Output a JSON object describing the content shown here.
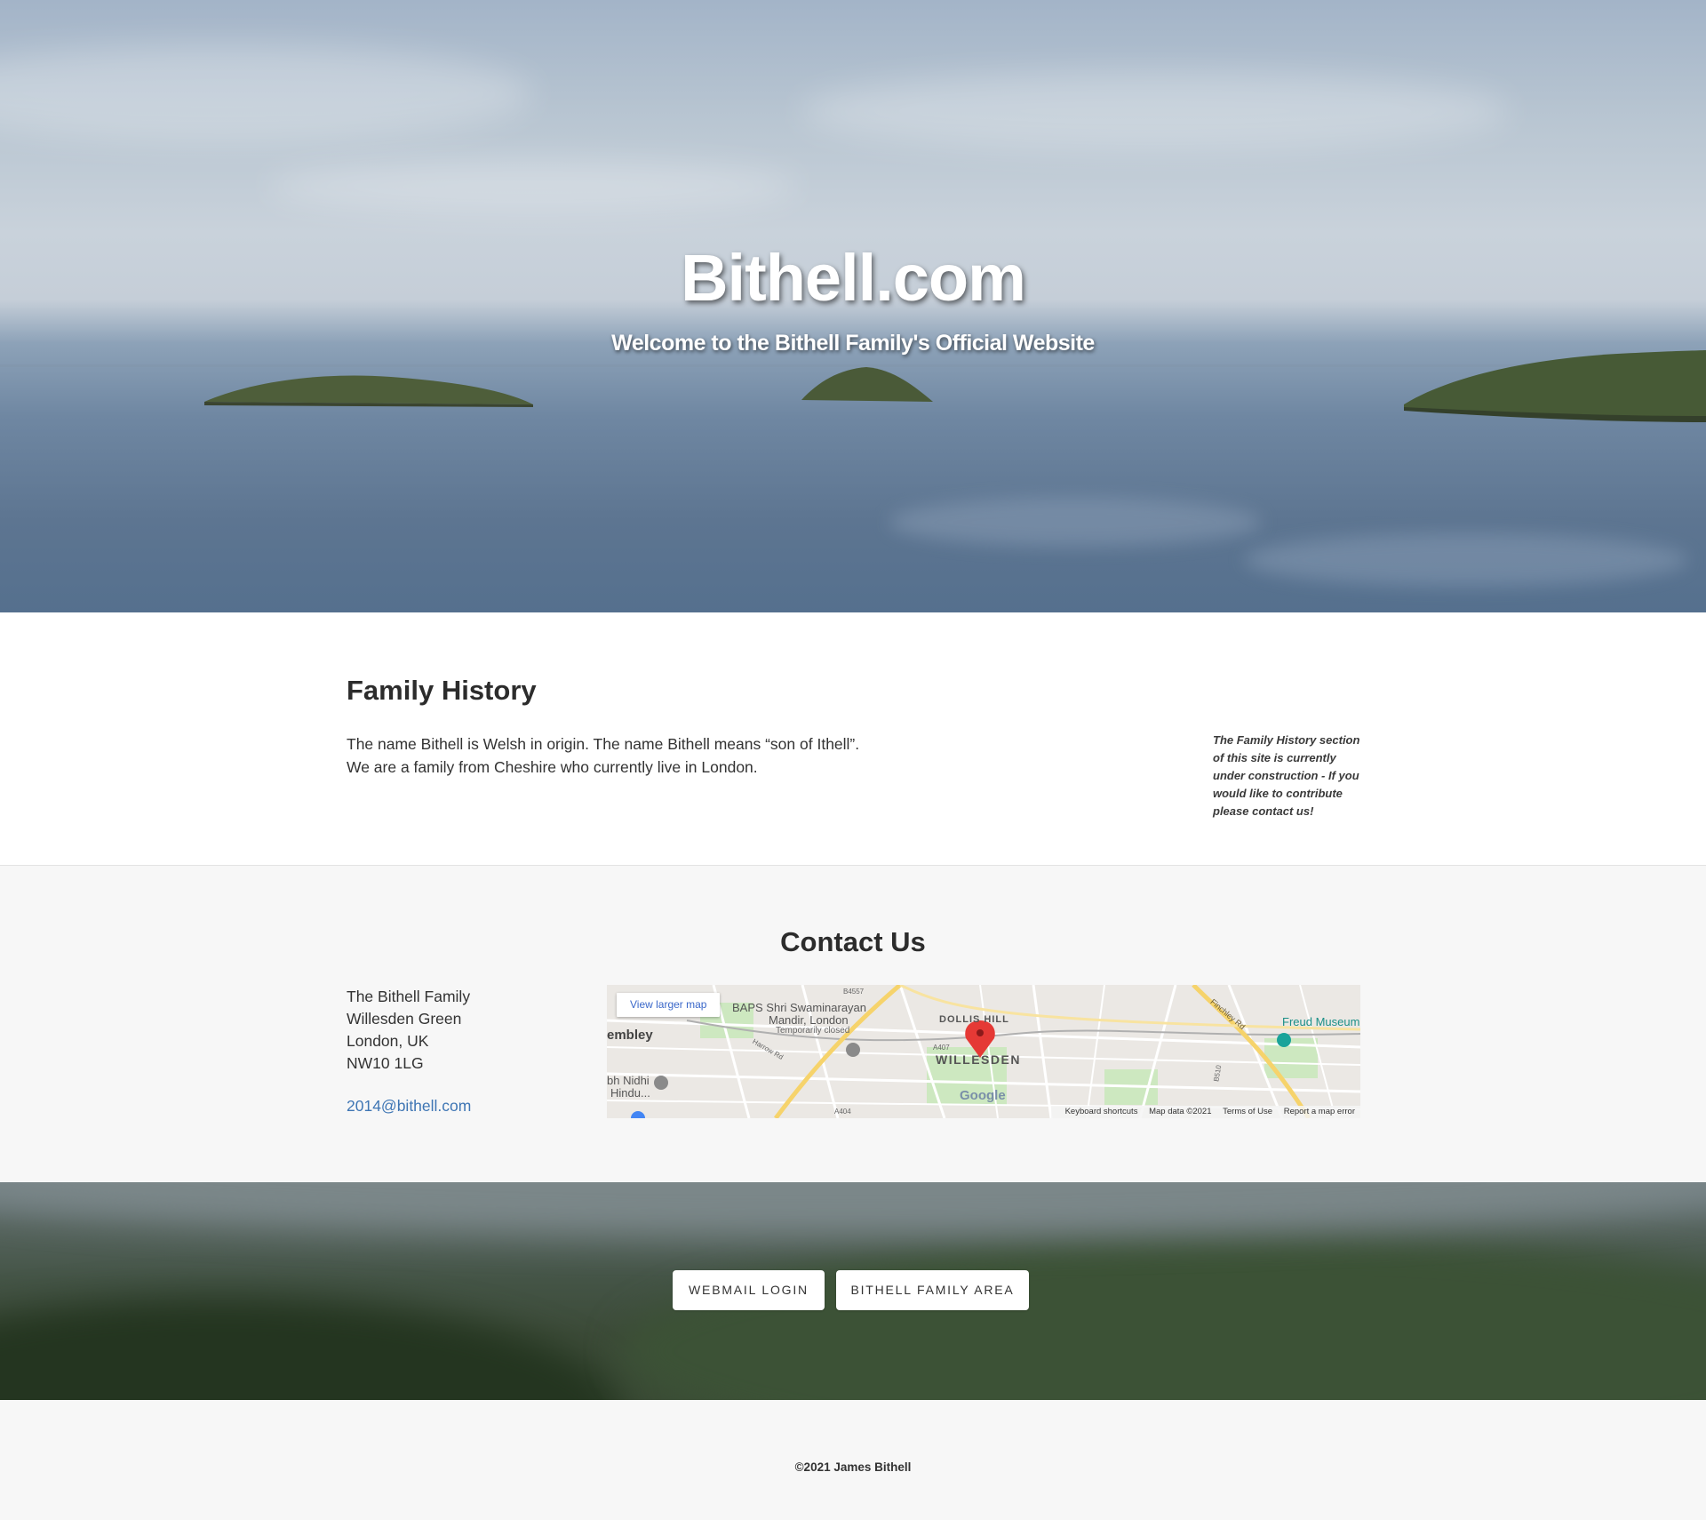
{
  "hero": {
    "title": "Bithell.com",
    "subtitle": "Welcome to the Bithell Family's Official Website"
  },
  "history": {
    "heading": "Family History",
    "lines": [
      "The name Bithell is Welsh in origin. The name Bithell means “son of Ithell”.",
      "We are a family from Cheshire who currently live in London."
    ],
    "note": "The Family History section of this site is currently under construction - If you would like to contribute please contact us!"
  },
  "contact": {
    "heading": "Contact Us",
    "address": [
      "The Bithell Family",
      "Willesden Green",
      "London, UK",
      "NW10 1LG"
    ],
    "email": "2014@bithell.com"
  },
  "map": {
    "view_larger": "View larger map",
    "labels": {
      "baps": "BAPS Shri Swaminarayan",
      "mandir": "Mandir, London",
      "temp_closed": "Temporarily closed",
      "wembley": "embley",
      "dollis_hill": "DOLLIS HILL",
      "willesden": "WILLESDEN",
      "freud": "Freud Museum L",
      "nidhi1": "bh Nidhi",
      "nidhi2": "Hindu...",
      "finchley": "Finchley Rd",
      "harrow": "Harrow Rd",
      "b4557": "B4557",
      "a407": "A407",
      "a404": "A404",
      "b510": "B510"
    },
    "google": "Google",
    "footer": [
      "Keyboard shortcuts",
      "Map data ©2021",
      "Terms of Use",
      "Report a map error"
    ]
  },
  "buttons": {
    "webmail": "WEBMAIL LOGIN",
    "family_area": "BITHELL FAMILY AREA"
  },
  "footer": {
    "copyright": "©2021 James Bithell"
  },
  "colors": {
    "link": "#3f76b4",
    "map_pin": "#e53935",
    "map_road_yellow": "#f6d36b"
  }
}
